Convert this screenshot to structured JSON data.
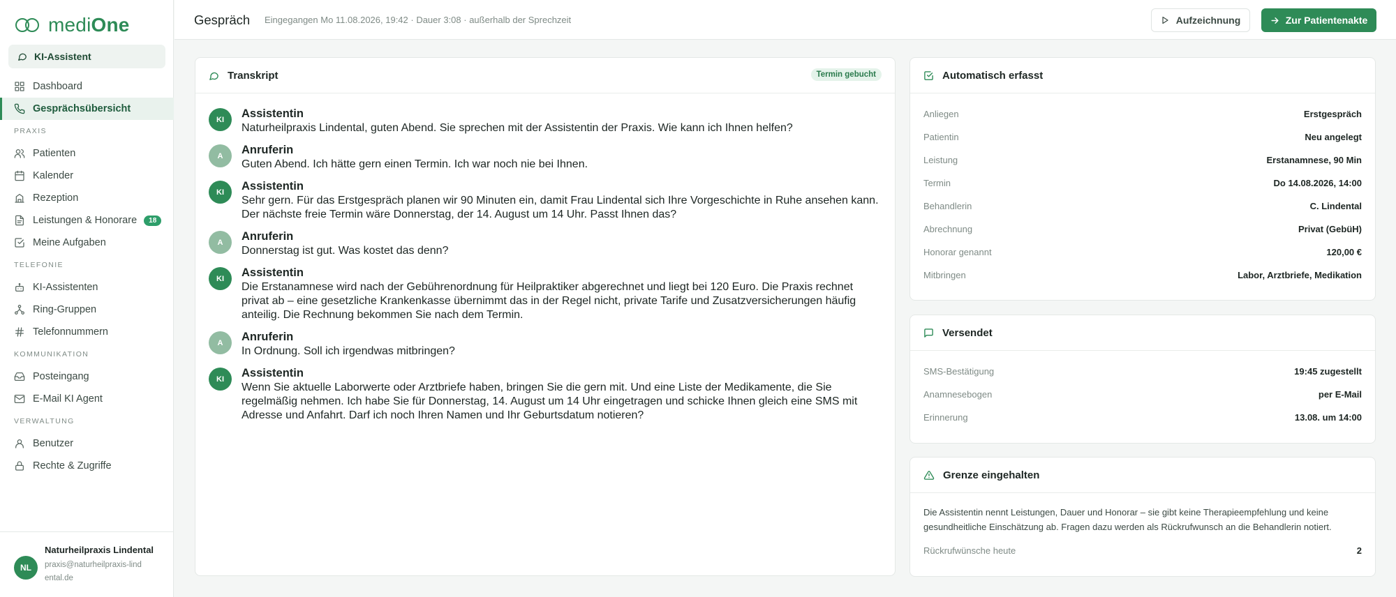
{
  "app": {
    "brand_light": "medi",
    "brand_bold": "One",
    "assistant_button": "KI-Assistent"
  },
  "sidebar": {
    "top_items": [
      {
        "label": "Dashboard",
        "icon": "grid-icon"
      },
      {
        "label": "Gesprächsübersicht",
        "icon": "phone-icon",
        "active": true
      }
    ],
    "sections": [
      {
        "title": "PRAXIS",
        "items": [
          {
            "label": "Patienten",
            "icon": "users-icon"
          },
          {
            "label": "Kalender",
            "icon": "calendar-icon"
          },
          {
            "label": "Rezeption",
            "icon": "building-icon"
          },
          {
            "label": "Leistungen & Honorare",
            "icon": "document-icon",
            "badge": "18"
          },
          {
            "label": "Meine Aufgaben",
            "icon": "checkbox-icon"
          }
        ]
      },
      {
        "title": "TELEFONIE",
        "items": [
          {
            "label": "KI-Assistenten",
            "icon": "bot-icon"
          },
          {
            "label": "Ring-Gruppen",
            "icon": "network-icon"
          },
          {
            "label": "Telefonnummern",
            "icon": "hash-icon"
          }
        ]
      },
      {
        "title": "KOMMUNIKATION",
        "items": [
          {
            "label": "Posteingang",
            "icon": "inbox-icon"
          },
          {
            "label": "E-Mail KI Agent",
            "icon": "mail-icon"
          }
        ]
      },
      {
        "title": "VERWALTUNG",
        "items": [
          {
            "label": "Benutzer",
            "icon": "user-icon"
          },
          {
            "label": "Rechte & Zugriffe",
            "icon": "lock-icon"
          }
        ]
      }
    ],
    "account": {
      "initials": "NL",
      "name": "Naturheilpraxis Lindental",
      "email": "praxis@naturheilpraxis-lindental.de"
    }
  },
  "header": {
    "title": "Gespräch",
    "meta": "Eingegangen Mo 11.08.2026, 19:42 · Dauer 3:08 · außerhalb der Sprechzeit",
    "recording_button": "Aufzeichnung",
    "patient_button": "Zur Patientenakte"
  },
  "transcript": {
    "title": "Transkript",
    "tag": "Termin gebucht",
    "messages": [
      {
        "initials": "KI",
        "speaker": "Assistentin",
        "text": "Naturheilpraxis Lindental, guten Abend. Sie sprechen mit der Assistentin der Praxis. Wie kann ich Ihnen helfen?"
      },
      {
        "initials": "A",
        "speaker": "Anruferin",
        "text": "Guten Abend. Ich hätte gern einen Termin. Ich war noch nie bei Ihnen."
      },
      {
        "initials": "KI",
        "speaker": "Assistentin",
        "text": "Sehr gern. Für das Erstgespräch planen wir 90 Minuten ein, damit Frau Lindental sich Ihre Vorgeschichte in Ruhe ansehen kann. Der nächste freie Termin wäre Donnerstag, der 14. August um 14 Uhr. Passt Ihnen das?"
      },
      {
        "initials": "A",
        "speaker": "Anruferin",
        "text": "Donnerstag ist gut. Was kostet das denn?"
      },
      {
        "initials": "KI",
        "speaker": "Assistentin",
        "text": "Die Erstanamnese wird nach der Gebührenordnung für Heilpraktiker abgerechnet und liegt bei 120 Euro. Die Praxis rechnet privat ab – eine gesetzliche Krankenkasse übernimmt das in der Regel nicht, private Tarife und Zusatzversicherungen häufig anteilig. Die Rechnung bekommen Sie nach dem Termin."
      },
      {
        "initials": "A",
        "speaker": "Anruferin",
        "text": "In Ordnung. Soll ich irgendwas mitbringen?"
      },
      {
        "initials": "KI",
        "speaker": "Assistentin",
        "text": "Wenn Sie aktuelle Laborwerte oder Arztbriefe haben, bringen Sie die gern mit. Und eine Liste der Medikamente, die Sie regelmäßig nehmen. Ich habe Sie für Donnerstag, 14. August um 14 Uhr eingetragen und schicke Ihnen gleich eine SMS mit Adresse und Anfahrt. Darf ich noch Ihren Namen und Ihr Geburtsdatum notieren?"
      }
    ]
  },
  "summary": {
    "title": "Automatisch erfasst",
    "rows": [
      {
        "key": "Anliegen",
        "value": "Erstgespräch"
      },
      {
        "key": "Patientin",
        "value": "Neu angelegt"
      },
      {
        "key": "Leistung",
        "value": "Erstanamnese, 90 Min"
      },
      {
        "key": "Termin",
        "value": "Do 14.08.2026, 14:00"
      },
      {
        "key": "Behandlerin",
        "value": "C. Lindental"
      },
      {
        "key": "Abrechnung",
        "value": "Privat (GebüH)"
      },
      {
        "key": "Honorar genannt",
        "value": "120,00 €"
      },
      {
        "key": "Mitbringen",
        "value": "Labor, Arztbriefe, Medikation"
      }
    ]
  },
  "sent": {
    "title": "Versendet",
    "rows": [
      {
        "key": "SMS-Bestätigung",
        "value": "19:45 zugestellt"
      },
      {
        "key": "Anamnesebogen",
        "value": "per E-Mail"
      },
      {
        "key": "Erinnerung",
        "value": "13.08. um 14:00"
      }
    ]
  },
  "limit": {
    "title": "Grenze eingehalten",
    "text": "Die Assistentin nennt Leistungen, Dauer und Honorar – sie gibt keine Therapieempfehlung und keine gesundheitliche Einschätzung ab. Fragen dazu werden als Rückrufwunsch an die Behandlerin notiert.",
    "callbacks_label": "Rückrufwünsche heute",
    "callbacks_value": "2"
  },
  "colors": {
    "accent": "#2e8b57",
    "accent_light": "#e9f2ed",
    "caller_avatar": "#92bca2"
  }
}
